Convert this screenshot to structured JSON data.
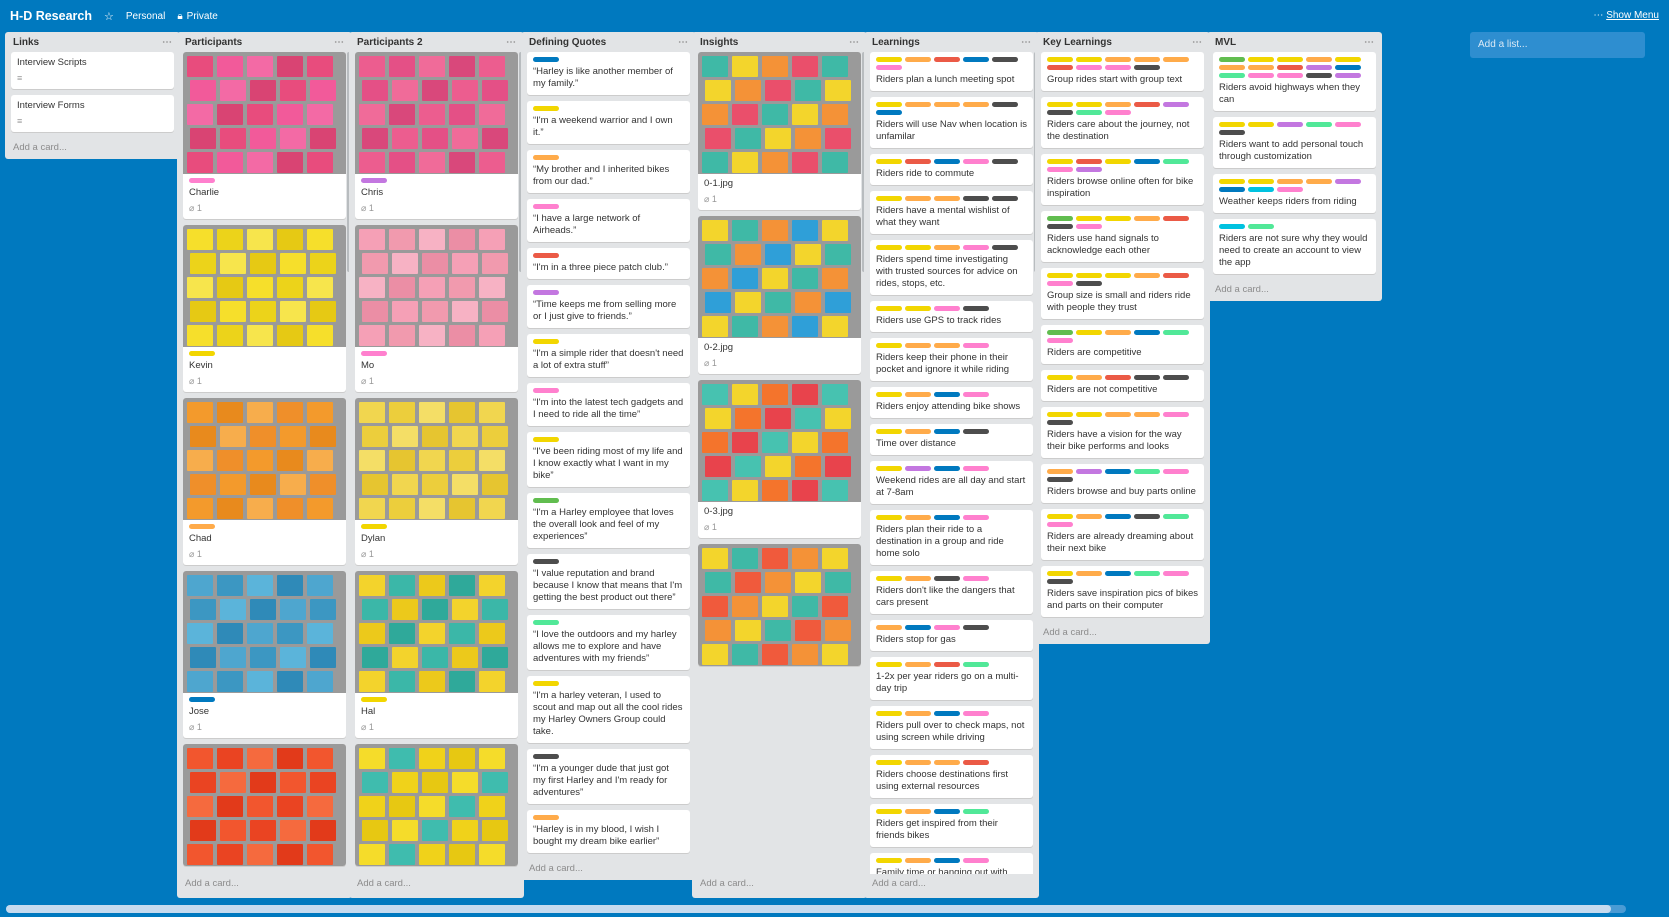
{
  "board": {
    "title": "H-D Research",
    "team": "Personal",
    "visibility": "Private",
    "show_menu": "Show Menu",
    "add_list": "Add a list..."
  },
  "add_card": "Add a card...",
  "colors": {
    "green": "#61bd4f",
    "yellow": "#f2d600",
    "orange": "#ffab4a",
    "red": "#eb5a46",
    "purple": "#c377e0",
    "blue": "#0079bf",
    "sky": "#00c2e0",
    "lime": "#51e898",
    "pink": "#ff80ce",
    "black": "#4d4d4d"
  },
  "lists": {
    "links": {
      "title": "Links",
      "cards": [
        {
          "title": "Interview Scripts"
        },
        {
          "title": "Interview Forms"
        }
      ]
    },
    "participants": {
      "title": "Participants",
      "cards": [
        {
          "title": "Charlie",
          "label": "pink",
          "count": "1",
          "palette": [
            "#e84c7d",
            "#f25a9a",
            "#f36aa5",
            "#d94473"
          ]
        },
        {
          "title": "Kevin",
          "label": "yellow",
          "count": "1",
          "palette": [
            "#f6df2b",
            "#ecd31a",
            "#f7e54c",
            "#e6c914"
          ]
        },
        {
          "title": "Chad",
          "label": "orange",
          "count": "1",
          "palette": [
            "#f39a2c",
            "#e88a1d",
            "#f7ad4c",
            "#ef8f2a"
          ]
        },
        {
          "title": "Jose",
          "label": "blue",
          "count": "1",
          "palette": [
            "#4ea6cf",
            "#3c97c2",
            "#5bb4da",
            "#2f8ab8"
          ]
        },
        {
          "title": "",
          "label": "",
          "count": "",
          "palette": [
            "#f2562e",
            "#ea4422",
            "#f56a3e",
            "#e23a1a"
          ]
        }
      ]
    },
    "participants2": {
      "title": "Participants 2",
      "cards": [
        {
          "title": "Chris",
          "label": "purple",
          "count": "1",
          "palette": [
            "#ec5d8f",
            "#e45086",
            "#f06b99",
            "#d9487b"
          ]
        },
        {
          "title": "Mo",
          "label": "pink",
          "count": "1",
          "palette": [
            "#f5a0b6",
            "#f19aae",
            "#f7b2c4",
            "#eb8ea5"
          ]
        },
        {
          "title": "Dylan",
          "label": "yellow",
          "count": "1",
          "palette": [
            "#f1d64f",
            "#ecce3c",
            "#f4de66",
            "#e6c530"
          ]
        },
        {
          "title": "Hal",
          "label": "yellow",
          "count": "1",
          "palette": [
            "#f3d32c",
            "#3bb7a8",
            "#ecc91b",
            "#2fa99a"
          ]
        },
        {
          "title": "",
          "label": "",
          "count": "",
          "palette": [
            "#f5dc2a",
            "#3fbcae",
            "#f0d21a",
            "#e7c812"
          ]
        }
      ]
    },
    "quotes": {
      "title": "Defining Quotes",
      "cards": [
        {
          "title": "“Harley is like another member of my family.”",
          "label": "blue"
        },
        {
          "title": "“I'm a weekend warrior and I own it.”",
          "label": "yellow"
        },
        {
          "title": "“My brother and I inherited bikes from our dad.”",
          "label": "orange"
        },
        {
          "title": "“I have a large network of Airheads.”",
          "label": "pink"
        },
        {
          "title": "“I'm in a three piece patch club.”",
          "label": "red"
        },
        {
          "title": "“Time keeps me from selling more or I just give to friends.”",
          "label": "purple"
        },
        {
          "title": "“I'm a simple rider that doesn't need a lot of extra stuff”",
          "label": "yellow"
        },
        {
          "title": "“I'm into the latest tech gadgets and I need to ride all the time”",
          "label": "pink"
        },
        {
          "title": "“I've been riding most of my life and I know exactly what I want in my bike”",
          "label": "yellow"
        },
        {
          "title": "“I'm a Harley employee that loves the overall look and feel of my experiences”",
          "label": "green"
        },
        {
          "title": "“I value reputation and brand because I know that means that I'm getting the best product out there”",
          "label": "black"
        },
        {
          "title": "“I love the outdoors and my harley allows me to explore and have adventures with my friends”",
          "label": "lime"
        },
        {
          "title": "“I'm a harley veteran, I used to scout and map out all the cool rides my Harley Owners Group could take.",
          "label": "yellow"
        },
        {
          "title": "“I'm a younger dude that just got my first Harley and I'm ready for adventures”",
          "label": "black"
        },
        {
          "title": "“Harley is in my blood, I wish I bought my dream bike earlier”",
          "label": "orange"
        }
      ]
    },
    "insights": {
      "title": "Insights",
      "cards": [
        {
          "title": "0-1.jpg",
          "count": "1",
          "palette": [
            "#3fb9a6",
            "#f3d52c",
            "#f49237",
            "#ea4f6b"
          ]
        },
        {
          "title": "0-2.jpg",
          "count": "1",
          "palette": [
            "#f3d52c",
            "#3fb9a6",
            "#f49237",
            "#2f9fd8"
          ]
        },
        {
          "title": "0-3.jpg",
          "count": "1",
          "palette": [
            "#47c2b0",
            "#f3d52c",
            "#f4742c",
            "#e8434c"
          ]
        },
        {
          "title": "",
          "count": "",
          "palette": [
            "#f3d52c",
            "#3fb9a6",
            "#f05a3c",
            "#f49237"
          ]
        }
      ]
    },
    "learnings": {
      "title": "Learnings",
      "cards": [
        {
          "title": "Riders plan a lunch meeting spot",
          "labels": [
            "yellow",
            "orange",
            "red",
            "blue",
            "black",
            "pink"
          ]
        },
        {
          "title": "Riders will use Nav when location is unfamilar",
          "labels": [
            "yellow",
            "orange",
            "orange",
            "orange",
            "black",
            "blue"
          ]
        },
        {
          "title": "Riders ride to commute",
          "labels": [
            "yellow",
            "red",
            "blue",
            "pink",
            "black"
          ]
        },
        {
          "title": "Riders have a mental wishlist of what they want",
          "labels": [
            "yellow",
            "orange",
            "orange",
            "black",
            "black"
          ]
        },
        {
          "title": "Riders spend time investigating with trusted sources for advice on rides, stops, etc.",
          "labels": [
            "yellow",
            "yellow",
            "orange",
            "pink",
            "black"
          ]
        },
        {
          "title": "Riders use GPS to track rides",
          "labels": [
            "yellow",
            "yellow",
            "pink",
            "black"
          ]
        },
        {
          "title": "Riders keep their phone in their pocket and ignore it while riding",
          "labels": [
            "yellow",
            "orange",
            "orange",
            "pink"
          ]
        },
        {
          "title": "Riders enjoy attending bike shows",
          "labels": [
            "yellow",
            "orange",
            "blue",
            "pink"
          ]
        },
        {
          "title": "Time over distance",
          "labels": [
            "yellow",
            "orange",
            "blue",
            "black"
          ]
        },
        {
          "title": "Weekend rides are all day and start at 7-8am",
          "labels": [
            "yellow",
            "purple",
            "blue",
            "pink"
          ]
        },
        {
          "title": "Riders plan their ride to a destination in a group and ride home solo",
          "labels": [
            "yellow",
            "orange",
            "blue",
            "pink"
          ]
        },
        {
          "title": "Riders don't like the dangers that cars present",
          "labels": [
            "yellow",
            "orange",
            "black",
            "pink"
          ]
        },
        {
          "title": "Riders stop for gas",
          "labels": [
            "orange",
            "blue",
            "pink",
            "black"
          ]
        },
        {
          "title": "1-2x per year riders go on a multi-day trip",
          "labels": [
            "yellow",
            "orange",
            "red",
            "lime"
          ]
        },
        {
          "title": "Riders pull over to check maps, not using screen while driving",
          "labels": [
            "yellow",
            "orange",
            "blue",
            "pink"
          ]
        },
        {
          "title": "Riders choose destinations first using external resources",
          "labels": [
            "yellow",
            "orange",
            "orange",
            "red"
          ]
        },
        {
          "title": "Riders get inspired from their friends bikes",
          "labels": [
            "yellow",
            "orange",
            "blue",
            "lime"
          ]
        },
        {
          "title": "Family time or hanging out with friends is a reason not to ride",
          "labels": [
            "yellow",
            "orange",
            "blue",
            "pink"
          ]
        }
      ]
    },
    "key": {
      "title": "Key Learnings",
      "cards": [
        {
          "title": "Group rides start with group text",
          "labels": [
            "yellow",
            "yellow",
            "orange",
            "orange",
            "orange",
            "red",
            "pink",
            "pink",
            "black"
          ]
        },
        {
          "title": "Riders care about the journey, not the destination",
          "labels": [
            "yellow",
            "yellow",
            "orange",
            "red",
            "purple",
            "black",
            "lime",
            "pink"
          ]
        },
        {
          "title": "Riders browse online often for bike inspiration",
          "labels": [
            "yellow",
            "red",
            "yellow",
            "blue",
            "lime",
            "pink",
            "purple"
          ]
        },
        {
          "title": "Riders use hand signals to acknowledge each other",
          "labels": [
            "green",
            "yellow",
            "yellow",
            "orange",
            "red",
            "black",
            "pink"
          ]
        },
        {
          "title": "Group size is small and riders ride with people they trust",
          "labels": [
            "yellow",
            "yellow",
            "yellow",
            "orange",
            "red",
            "pink",
            "black"
          ]
        },
        {
          "title": "Riders are competitive",
          "labels": [
            "green",
            "yellow",
            "orange",
            "blue",
            "lime",
            "pink"
          ]
        },
        {
          "title": "Riders are not competitive",
          "labels": [
            "yellow",
            "orange",
            "red",
            "black",
            "black"
          ]
        },
        {
          "title": "Riders have a vision for the way their bike performs and looks",
          "labels": [
            "yellow",
            "yellow",
            "orange",
            "orange",
            "pink",
            "black"
          ]
        },
        {
          "title": "Riders browse and buy parts online",
          "labels": [
            "orange",
            "purple",
            "blue",
            "lime",
            "pink",
            "black"
          ]
        },
        {
          "title": "Riders are already dreaming about their next bike",
          "labels": [
            "yellow",
            "orange",
            "blue",
            "black",
            "lime",
            "pink"
          ]
        },
        {
          "title": "Riders save inspiration pics of bikes and parts on their computer",
          "labels": [
            "yellow",
            "orange",
            "blue",
            "lime",
            "pink",
            "black"
          ]
        }
      ]
    },
    "mvl": {
      "title": "MVL",
      "cards": [
        {
          "title": "Riders avoid highways when they can",
          "labels": [
            "green",
            "yellow",
            "yellow",
            "orange",
            "yellow",
            "orange",
            "orange",
            "red",
            "purple",
            "blue",
            "lime",
            "pink",
            "pink",
            "black",
            "purple"
          ]
        },
        {
          "title": "Riders want to add personal touch through customization",
          "labels": [
            "yellow",
            "yellow",
            "purple",
            "lime",
            "pink",
            "black"
          ]
        },
        {
          "title": "Weather keeps riders from riding",
          "labels": [
            "yellow",
            "yellow",
            "orange",
            "orange",
            "purple",
            "blue",
            "sky",
            "pink"
          ]
        },
        {
          "title": "Riders are not sure why they would need to create an account to view the app",
          "labels": [
            "sky",
            "lime"
          ]
        }
      ]
    }
  }
}
